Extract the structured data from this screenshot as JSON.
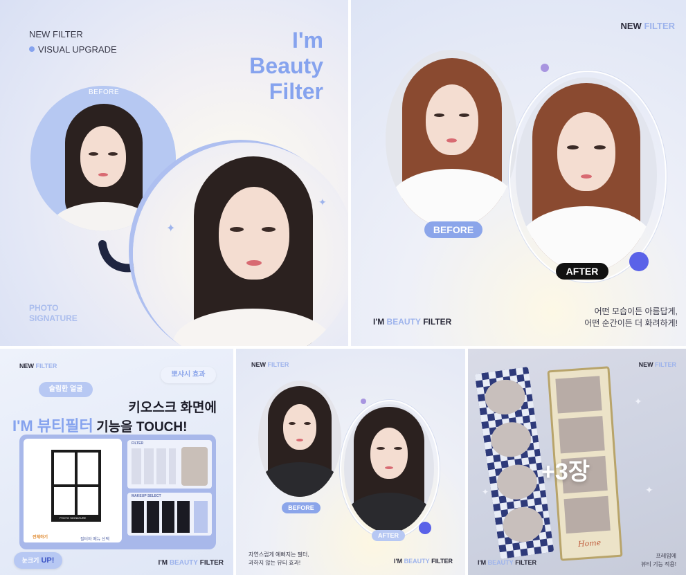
{
  "panel1": {
    "new_filter": "NEW FILTER",
    "visual_upgrade": "VISUAL UPGRADE",
    "title_line1": "I'm",
    "title_line2": "Beauty",
    "title_line3": "Filter",
    "before_label": "BEFORE",
    "photo": "PHOTO",
    "signature": "SIGNATURE"
  },
  "panel2": {
    "new": "NEW",
    "filter": "FILTER",
    "before_label": "BEFORE",
    "after_label": "AFTER",
    "brand_im": "I'M",
    "brand_beauty": "BEAUTY",
    "brand_filter": "FILTER",
    "caption_line1": "어떤 모습이든 아름답게,",
    "caption_line2": "어떤 순간이든 더 화려하게!"
  },
  "panel3": {
    "new": "NEW",
    "filter": "FILTER",
    "effect_badge": "뽀샤시 효과",
    "slim_badge": "슬림한 얼굴",
    "headline1": "키오스크 화면에",
    "headline2_prefix": "I'M 뷰티필터",
    "headline2_suffix": "기능을 TOUCH!",
    "frame_caption": "PHOTO SIGNATURE",
    "filter_header": "FILTER",
    "makeup_header": "MAKEUP SELECT",
    "btn_left": "전체하기",
    "btn_right": "필터와 메뉴 선택",
    "eye_badge_prefix": "눈크기",
    "eye_badge_suffix": "UP!",
    "brand_im": "I'M",
    "brand_beauty": "BEAUTY",
    "brand_filter": "FILTER"
  },
  "panel4": {
    "new": "NEW",
    "filter": "FILTER",
    "before_label": "BEFORE",
    "after_label": "AFTER",
    "caption_line1": "자연스럽게 예뻐지는 필터,",
    "caption_line2": "과하지 않는 뷰티 효과!",
    "brand_im": "I'M",
    "brand_beauty": "BEAUTY",
    "brand_filter": "FILTER"
  },
  "panel5": {
    "new": "NEW",
    "filter": "FILTER",
    "count": "+3장",
    "strip_text": "Home",
    "caption_line1": "프레임에",
    "caption_line2": "뷰티 기능 적용!",
    "brand_im": "I'M",
    "brand_beauty": "BEAUTY",
    "brand_filter": "FILTER"
  },
  "colors": {
    "accent_blue": "#86a3ee",
    "pill_blue": "#8ba5ea",
    "dark_pill": "#111111",
    "dot_purple": "#a895e0",
    "dot_indigo": "#5a62e8",
    "hair_dark": "#2b211f",
    "hair_auburn": "#8a4a30"
  }
}
